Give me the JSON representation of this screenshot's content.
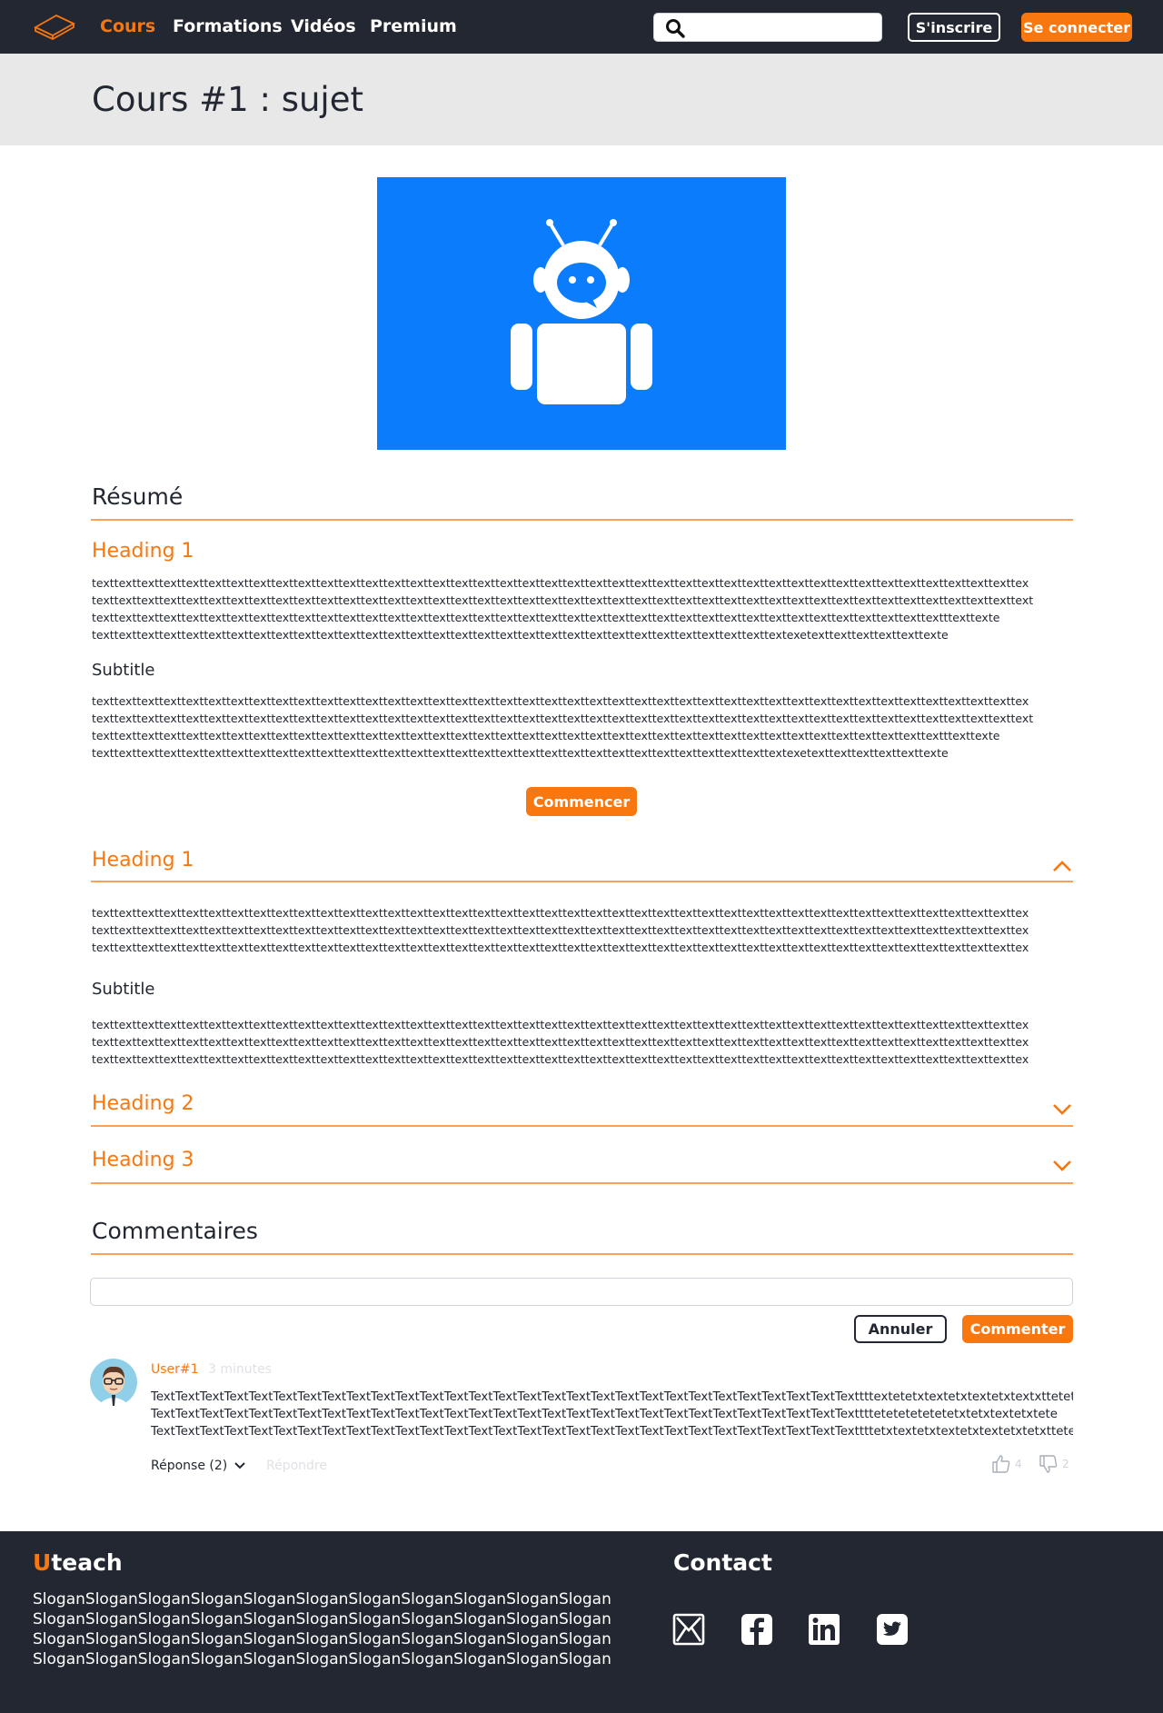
{
  "nav": {
    "logo": "book-logo-icon",
    "links": [
      "Cours",
      "Formations",
      "Vidéos",
      "Premium"
    ],
    "active_link": "Cours",
    "search_value": "",
    "signup_label": "S'inscrire",
    "login_label": "Se connecter"
  },
  "page": {
    "title": "Cours #1 : sujet"
  },
  "hero": {
    "image": "robot-illustration",
    "background": "#0A7CFC"
  },
  "summary": {
    "title": "Résumé",
    "heading": "Heading 1",
    "text1": "texttexttexttexttexttexttexttexttexttexttexttexttexttexttexttexttexttexttexttexttexttexttexttexttexttexttexttexttexttexttexttexttexttexttexttexttexttexttexttexttexttex\ntexttexttexttexttexttexttexttexttexttexttexttexttexttexttexttexttexttexttexttexttexttexttexttexttexttexttexttexttexttexttexttexttexttexttexttexttexttexttexttexttexttext\ntexttexttexttexttexttexttexttexttexttexttexttexttexttexttexttexttexttexttexttexttexttexttexttexttexttexttexttexttexttexttexttexttexttexttexttexttexttextttexttexte\ntexttexttexttexttexttexttexttexttexttexttexttexttexttexttexttexttexttexttexttexttexttexttexttexttexttexttexttexttexttexttextexetexttexttexttexttexttexte",
    "subtitle": "Subtitle",
    "text2": "texttexttexttexttexttexttexttexttexttexttexttexttexttexttexttexttexttexttexttexttexttexttexttexttexttexttexttexttexttexttexttexttexttexttexttexttexttexttexttexttexttex\ntexttexttexttexttexttexttexttexttexttexttexttexttexttexttexttexttexttexttexttexttexttexttexttexttexttexttexttexttexttexttexttexttexttexttexttexttexttexttexttexttexttext\ntexttexttexttexttexttexttexttexttexttexttexttexttexttexttexttexttexttexttexttexttexttexttexttexttexttexttexttexttexttexttexttexttexttexttexttexttexttextttexttexte\ntexttexttexttexttexttexttexttexttexttexttexttexttexttexttexttexttexttexttexttexttexttexttexttexttexttexttexttexttexttexttextexetexttexttexttexttexttexte",
    "start_label": "Commencer"
  },
  "accordion": [
    {
      "heading": "Heading 1",
      "expanded": true,
      "icon": "chevron-up-icon",
      "text1": "texttexttexttexttexttexttexttexttexttexttexttexttexttexttexttexttexttexttexttexttexttexttexttexttexttexttexttexttexttexttexttexttexttexttexttexttexttexttexttexttexttex\ntexttexttexttexttexttexttexttexttexttexttexttexttexttexttexttexttexttexttexttexttexttexttexttexttexttexttexttexttexttexttexttexttexttexttexttexttexttexttexttexttexttex\ntexttexttexttexttexttexttexttexttexttexttexttexttexttexttexttexttexttexttexttexttexttexttexttexttexttexttexttexttexttexttexttexttexttexttexttexttexttexttexttexttexttex",
      "subtitle": "Subtitle",
      "text2": "texttexttexttexttexttexttexttexttexttexttexttexttexttexttexttexttexttexttexttexttexttexttexttexttexttexttexttexttexttexttexttexttexttexttexttexttexttexttexttexttexttex\ntexttexttexttexttexttexttexttexttexttexttexttexttexttexttexttexttexttexttexttexttexttexttexttexttexttexttexttexttexttexttexttexttexttexttexttexttexttexttexttexttexttex\ntexttexttexttexttexttexttexttexttexttexttexttexttexttexttexttexttexttexttexttexttexttexttexttexttexttexttexttexttexttexttexttexttexttexttexttexttexttexttexttexttexttex"
    },
    {
      "heading": "Heading 2",
      "expanded": false,
      "icon": "chevron-down-icon"
    },
    {
      "heading": "Heading 3",
      "expanded": false,
      "icon": "chevron-down-icon"
    }
  ],
  "comments": {
    "title": "Commentaires",
    "input_value": "",
    "cancel_label": "Annuler",
    "submit_label": "Commenter",
    "items": [
      {
        "user": "User#1",
        "time": "3 minutes",
        "text": "TextTextTextTextTextTextTextTextTextTextTextTextTextTextTextTextTextTextTextTextTextTextTextTextTextTextTextTextTexttttextetetxtextetxtextetxtextxttetet\nTextTextTextTextTextTextTextTextTextTextTextTextTextTextTextTextTextTextTextTextTextTextTextTextTextTextTextTextTexttttetetetetetetetxtetxtextetxtete\nTextTextTextTextTextTextTextTextTextTextTextTextTextTextTextTextTextTextTextTextTextTextTextTextTextTextTextTextTexttttetxtextetxtextetxtextetxtetxttete",
        "replies_label": "Réponse (2)",
        "reply_label": "Répondre",
        "likes": "4",
        "dislikes": "2"
      }
    ]
  },
  "footer": {
    "brand_first": "U",
    "brand_rest": "teach",
    "slogan": "SloganSloganSloganSloganSloganSloganSloganSloganSloganSloganSlogan\nSloganSloganSloganSloganSloganSloganSloganSloganSloganSloganSlogan\nSloganSloganSloganSloganSloganSloganSloganSloganSloganSloganSlogan\nSloganSloganSloganSloganSloganSloganSloganSloganSloganSloganSlogan",
    "contact_title": "Contact",
    "social": [
      "mail-icon",
      "facebook-icon",
      "linkedin-icon",
      "twitter-icon"
    ]
  },
  "colors": {
    "accent": "#F9770F",
    "dark": "#222731",
    "hero": "#0A7CFC",
    "band": "#E8E8E9"
  }
}
